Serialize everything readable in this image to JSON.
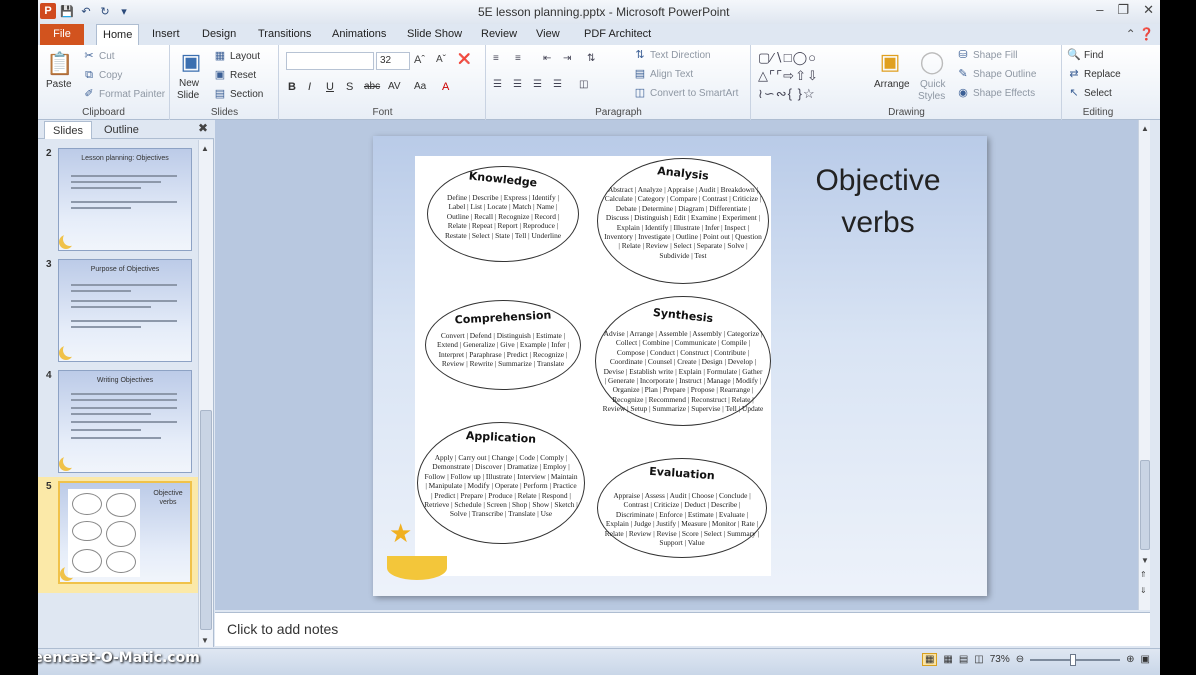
{
  "window": {
    "title": "5E lesson planning.pptx - Microsoft PowerPoint",
    "watermark": "Screencast-O-Matic.com"
  },
  "tabs": {
    "file": "File",
    "items": [
      "Home",
      "Insert",
      "Design",
      "Transitions",
      "Animations",
      "Slide Show",
      "Review",
      "View",
      "PDF Architect"
    ]
  },
  "ribbon": {
    "clipboard": {
      "label": "Clipboard",
      "paste": "Paste",
      "cut": "Cut",
      "copy": "Copy",
      "format_painter": "Format Painter"
    },
    "slides": {
      "label": "Slides",
      "new_slide": "New Slide",
      "new_slide_l1": "New",
      "new_slide_l2": "Slide",
      "layout": "Layout",
      "reset": "Reset",
      "section": "Section"
    },
    "font": {
      "label": "Font",
      "font_name": "",
      "font_size": "32"
    },
    "paragraph": {
      "label": "Paragraph",
      "text_direction": "Text Direction",
      "align_text": "Align Text",
      "convert_smartart": "Convert to SmartArt"
    },
    "drawing": {
      "label": "Drawing",
      "arrange": "Arrange",
      "quick_styles_l1": "Quick",
      "quick_styles_l2": "Styles",
      "shape_fill": "Shape Fill",
      "shape_outline": "Shape Outline",
      "shape_effects": "Shape Effects"
    },
    "editing": {
      "label": "Editing",
      "find": "Find",
      "replace": "Replace",
      "select": "Select"
    }
  },
  "pane": {
    "tab_slides": "Slides",
    "tab_outline": "Outline",
    "thumbnails": [
      {
        "num": "2",
        "title": "Lesson planning: Objectives"
      },
      {
        "num": "3",
        "title": "Purpose of Objectives"
      },
      {
        "num": "4",
        "title": "Writing Objectives"
      },
      {
        "num": "5",
        "title": "Objective verbs"
      }
    ]
  },
  "slide": {
    "title_line1": "Objective",
    "title_line2": "verbs",
    "categories": [
      {
        "title": "Knowledge",
        "verbs": "Define | Describe | Express | Identify | Label | List | Locate | Match | Name | Outline | Recall | Recognize | Record | Relate | Repeat | Report | Reproduce | Restate | Select | State | Tell | Underline"
      },
      {
        "title": "Analysis",
        "verbs": "Abstract | Analyze | Appraise | Audit | Breakdown | Calculate | Category | Compare | Contrast | Criticize | Debate | Determine | Diagram | Differentiate | Discuss | Distinguish | Edit | Examine | Experiment | Explain | Identify | Illustrate | Infer | Inspect | Inventory | Investigate | Outline | Point out | Question | Relate | Review | Select | Separate | Solve | Subdivide | Test"
      },
      {
        "title": "Comprehension",
        "verbs": "Convert | Defend | Distinguish | Estimate | Extend | Generalize | Give | Example | Infer | Interpret | Paraphrase | Predict | Recognize | Review | Rewrite | Summarize | Translate"
      },
      {
        "title": "Synthesis",
        "verbs": "Advise | Arrange | Assemble | Assembly | Categorize | Collect | Combine | Communicate | Compile | Compose | Conduct | Construct | Contribute | Coordinate | Counsel | Create | Design | Develop | Devise | Establish write | Explain | Formulate | Gather | Generate | Incorporate | Instruct | Manage | Modify | Organize | Plan | Prepare | Propose | Rearrange | Recognize | Recommend | Reconstruct | Relate | Review | Setup | Summarize | Supervise | Tell | Update"
      },
      {
        "title": "Application",
        "verbs": "Apply | Carry out | Change | Code | Comply | Demonstrate | Discover | Dramatize | Employ | Follow | Follow up | Illustrate | Interview | Maintain | Manipulate | Modify | Operate | Perform | Practice | Predict | Prepare | Produce | Relate | Respond | Retrieve | Schedule | Screen | Shop | Show | Sketch | Solve | Transcribe | Translate | Use"
      },
      {
        "title": "Evaluation",
        "verbs": "Appraise | Assess | Audit | Choose | Conclude | Contrast | Criticize | Deduct | Describe | Discriminate | Enforce | Estimate | Evaluate | Explain | Judge | Justify | Measure | Monitor | Rate | Relate | Review | Revise | Score | Select | Summary | Support | Value"
      }
    ]
  },
  "notes": {
    "placeholder": "Click to add notes"
  },
  "status": {
    "zoom": "73%"
  }
}
